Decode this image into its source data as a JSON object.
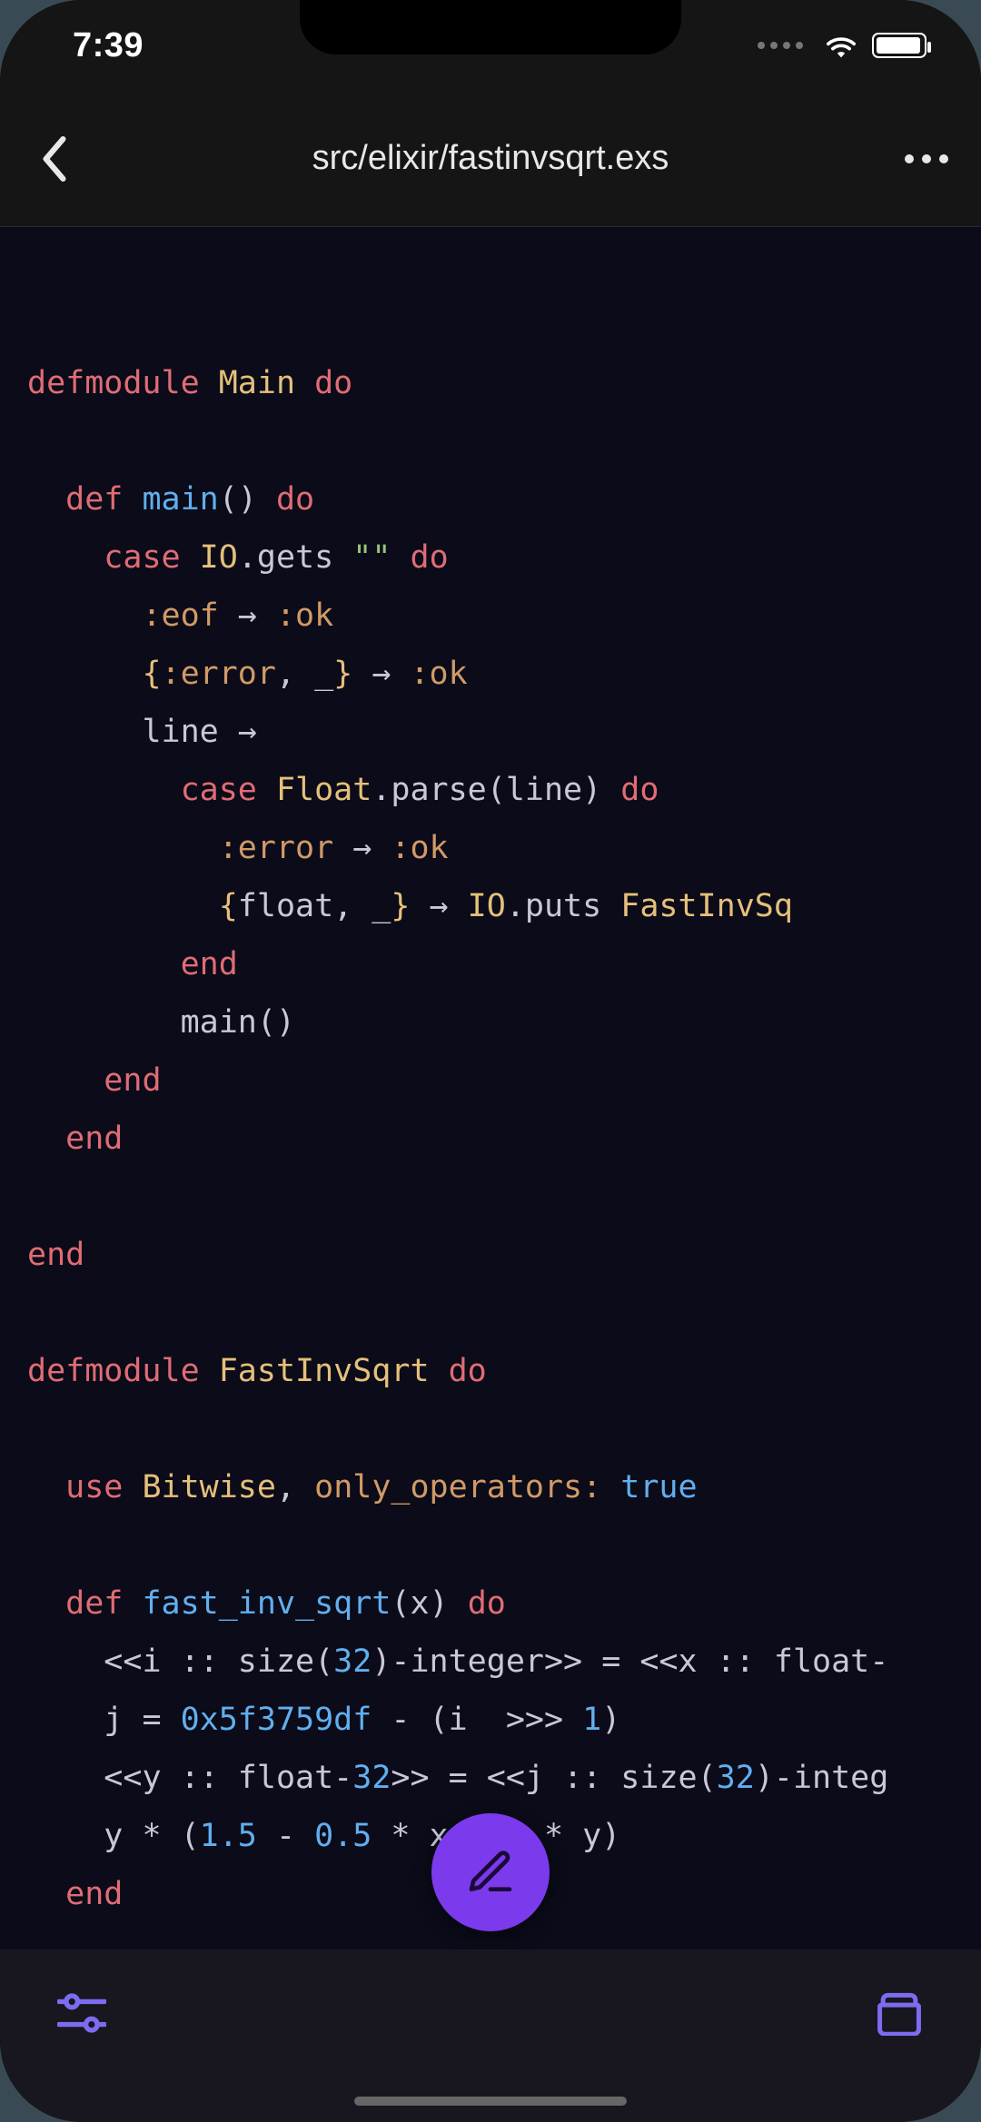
{
  "status": {
    "time": "7:39"
  },
  "nav": {
    "title": "src/elixir/fastinvsqrt.exs"
  },
  "code": {
    "l1_defmodule": "defmodule",
    "l1_main": "Main",
    "l1_do": "do",
    "l3_def": "def",
    "l3_main": "main",
    "l3_parens": "()",
    "l3_do": "do",
    "l4_case": "case",
    "l4_io": "IO",
    "l4_gets": ".gets ",
    "l4_str": "\"\"",
    "l4_do": "do",
    "l5_eof": ":eof",
    "l5_arrow": " → ",
    "l5_ok": ":ok",
    "l6_lbrace": "{",
    "l6_error": ":error",
    "l6_comma_us": ", _",
    "l6_rbrace": "}",
    "l6_arrow": " → ",
    "l6_ok": ":ok",
    "l7_line": "line ",
    "l7_arrow": "→",
    "l8_case": "case",
    "l8_float": "Float",
    "l8_parse": ".parse(line)",
    "l8_do": "do",
    "l9_error": ":error",
    "l9_arrow": " → ",
    "l9_ok": ":ok",
    "l10_lbrace": "{",
    "l10_float_us": "float, _",
    "l10_rbrace": "}",
    "l10_arrow": " → ",
    "l10_io": "IO",
    "l10_puts": ".puts ",
    "l10_fis": "FastInvSq",
    "l11_end": "end",
    "l12_main": "main()",
    "l13_end": "end",
    "l14_end": "end",
    "l16_end": "end",
    "l18_defmodule": "defmodule",
    "l18_fis": "FastInvSqrt",
    "l18_do": "do",
    "l20_use": "use",
    "l20_bitwise": "Bitwise",
    "l20_comma": ", ",
    "l20_only": "only_operators:",
    "l20_true": "true",
    "l22_def": "def",
    "l22_fn": "fast_inv_sqrt",
    "l22_args": "(x)",
    "l22_do": "do",
    "l23_a": "<<",
    "l23_b": "i :: size(",
    "l23_32a": "32",
    "l23_c": ")-integer",
    "l23_d": ">>",
    "l23_e": " = ",
    "l23_f": "<<",
    "l23_g": "x :: float-",
    "l24_a": "j = ",
    "l24_hex": "0x5f3759df",
    "l24_b": " - (i  >>> ",
    "l24_one": "1",
    "l24_c": ")",
    "l25_a": "<<",
    "l25_b": "y :: float-",
    "l25_32b": "32",
    "l25_c": ">>",
    "l25_d": " = ",
    "l25_e": "<<",
    "l25_f": "j :: size(",
    "l25_32c": "32",
    "l25_g": ")-integ",
    "l26_a": "y * (",
    "l26_15": "1.5",
    "l26_b": " - ",
    "l26_05": "0.5",
    "l26_c": " * x * y * y)",
    "l27_end": "end",
    "l29_end": "end"
  }
}
